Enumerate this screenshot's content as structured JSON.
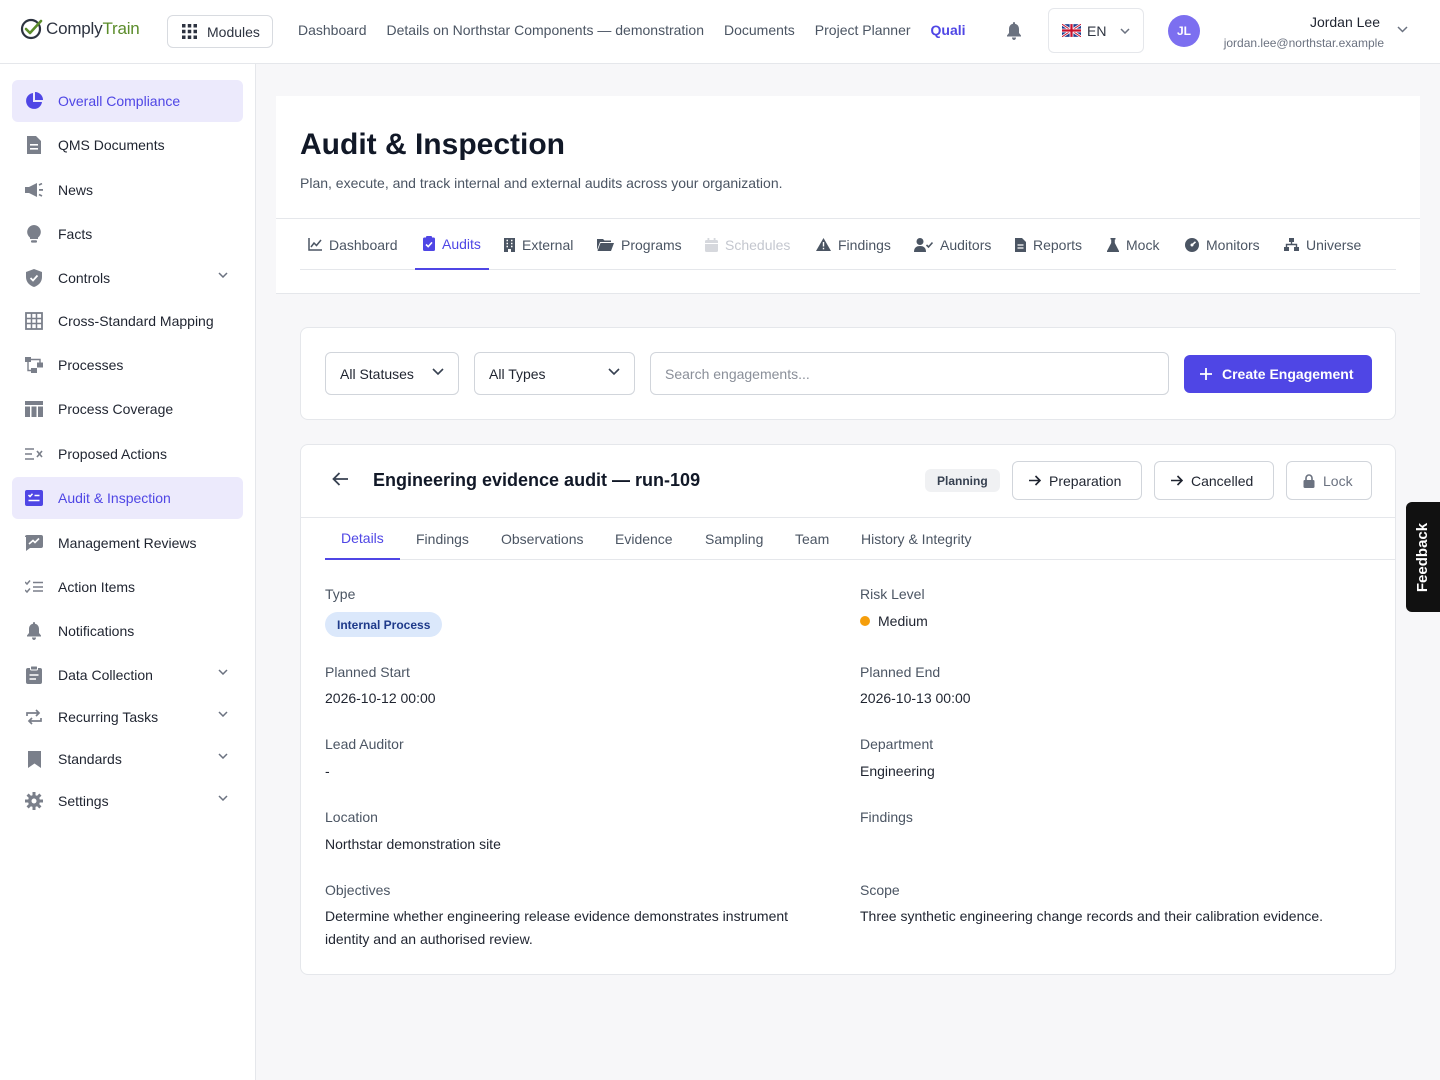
{
  "brand": {
    "part1": "Comply",
    "part2": "Train",
    "color_accent": "#4f46e5",
    "color_brand": "#5b8c2a"
  },
  "topbar": {
    "modules_label": "Modules",
    "nav": [
      "Dashboard",
      "Details on Northstar Components — demonstration",
      "Documents",
      "Project Planner",
      "Quali"
    ],
    "active_nav": "Quali",
    "language": "EN",
    "user": {
      "initials": "JL",
      "name": "Jordan Lee",
      "email": "jordan.lee@northstar.example"
    }
  },
  "sidebar": {
    "items": [
      {
        "label": "Overall Compliance",
        "icon": "pie-chart-icon",
        "active": true
      },
      {
        "label": "QMS Documents",
        "icon": "document-icon"
      },
      {
        "label": "News",
        "icon": "megaphone-icon"
      },
      {
        "label": "Facts",
        "icon": "lightbulb-icon"
      },
      {
        "label": "Controls",
        "icon": "shield-icon",
        "expandable": true
      },
      {
        "label": "Cross-Standard Mapping",
        "icon": "grid-icon"
      },
      {
        "label": "Processes",
        "icon": "flow-icon"
      },
      {
        "label": "Process Coverage",
        "icon": "table-icon"
      },
      {
        "label": "Proposed Actions",
        "icon": "list-x-icon"
      },
      {
        "label": "Audit & Inspection",
        "icon": "audit-icon",
        "active": true
      },
      {
        "label": "Management Reviews",
        "icon": "chart-edit-icon"
      },
      {
        "label": "Action Items",
        "icon": "checklist-icon"
      },
      {
        "label": "Notifications",
        "icon": "bell-icon"
      },
      {
        "label": "Data Collection",
        "icon": "clipboard-icon",
        "expandable": true
      },
      {
        "label": "Recurring Tasks",
        "icon": "repeat-icon",
        "expandable": true
      },
      {
        "label": "Standards",
        "icon": "bookmark-icon",
        "expandable": true
      },
      {
        "label": "Settings",
        "icon": "gear-icon",
        "expandable": true
      }
    ]
  },
  "page": {
    "title": "Audit & Inspection",
    "subtitle": "Plan, execute, and track internal and external audits across your organization.",
    "tabs": [
      {
        "label": "Dashboard",
        "icon": "line-chart-icon"
      },
      {
        "label": "Audits",
        "icon": "clipboard-check-icon",
        "active": true
      },
      {
        "label": "External",
        "icon": "building-icon"
      },
      {
        "label": "Programs",
        "icon": "folder-icon"
      },
      {
        "label": "Schedules",
        "icon": "calendar-icon",
        "disabled": true
      },
      {
        "label": "Findings",
        "icon": "warning-icon"
      },
      {
        "label": "Auditors",
        "icon": "user-check-icon"
      },
      {
        "label": "Reports",
        "icon": "report-icon"
      },
      {
        "label": "Mock",
        "icon": "flask-icon"
      },
      {
        "label": "Monitors",
        "icon": "monitor-icon"
      },
      {
        "label": "Universe",
        "icon": "hierarchy-icon"
      }
    ]
  },
  "filters": {
    "status_select": "All Statuses",
    "type_select": "All Types",
    "search_placeholder": "Search engagements...",
    "search_value": "",
    "create_label": "Create Engagement"
  },
  "engagement": {
    "title": "Engineering evidence audit — run-109",
    "status": "Planning",
    "actions": {
      "preparation": "Preparation",
      "cancelled": "Cancelled",
      "lock": "Lock"
    },
    "subtabs": [
      "Details",
      "Findings",
      "Observations",
      "Evidence",
      "Sampling",
      "Team",
      "History & Integrity"
    ],
    "active_subtab": "Details",
    "labels": {
      "type": "Type",
      "risk_level": "Risk Level",
      "planned_start": "Planned Start",
      "planned_end": "Planned End",
      "lead_auditor": "Lead Auditor",
      "department": "Department",
      "location": "Location",
      "findings": "Findings",
      "objectives": "Objectives",
      "scope": "Scope"
    },
    "values": {
      "type": "Internal Process",
      "risk_level": "Medium",
      "risk_color": "#f59e0b",
      "planned_start": "2026-10-12 00:00",
      "planned_end": "2026-10-13 00:00",
      "lead_auditor": "-",
      "department": "Engineering",
      "location": "Northstar demonstration site",
      "findings": "",
      "objectives": "Determine whether engineering release evidence demonstrates instrument identity and an authorised review.",
      "scope": "Three synthetic engineering change records and their calibration evidence."
    }
  },
  "feedback_label": "Feedback"
}
